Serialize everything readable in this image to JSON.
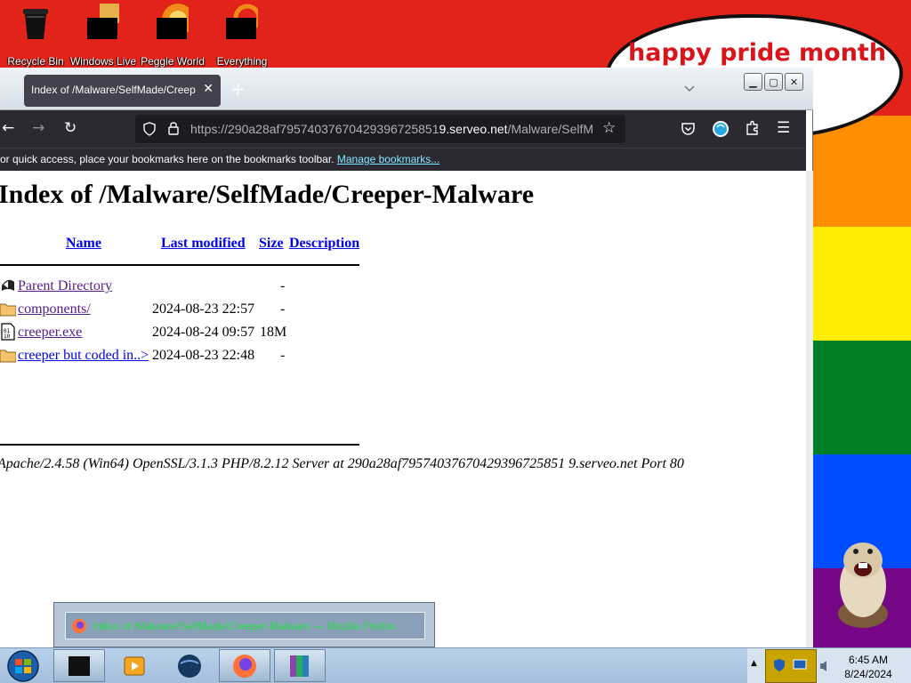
{
  "desktop": {
    "icons": [
      {
        "label": "Recycle Bin",
        "icon": "recycle-bin-icon"
      },
      {
        "label": "Windows Live",
        "icon": "windows-live-icon"
      },
      {
        "label": "Peggle World",
        "icon": "peggle-world-icon"
      },
      {
        "label": "Everything",
        "icon": "everything-search-icon"
      }
    ],
    "speech_bubble": "happy pride month",
    "colors": {
      "red": "#e2231a",
      "orange": "#fe8d00",
      "yellow": "#ffed00",
      "green": "#008026",
      "blue": "#004dff",
      "purple": "#750787"
    }
  },
  "browser": {
    "tab": {
      "title": "Index of /Malware/SelfMade/Creeper-Malware"
    },
    "url": {
      "prefix": "https://290a28af79574037670429396725851",
      "host_tail": "9.serveo.net",
      "path": "/Malware/SelfM"
    },
    "bookmarks_bar": {
      "text": "or quick access, place your bookmarks here on the bookmarks toolbar.",
      "link": "Manage bookmarks..."
    },
    "page": {
      "heading": "Index of /Malware/SelfMade/Creeper-Malware",
      "columns": [
        "Name",
        "Last modified",
        "Size",
        "Description"
      ],
      "rows": [
        {
          "name": "Parent Directory",
          "modified": "",
          "size": "-",
          "icon": "parent-directory-icon"
        },
        {
          "name": "components/",
          "modified": "2024-08-23 22:57",
          "size": "-",
          "icon": "folder-icon"
        },
        {
          "name": "creeper.exe",
          "modified": "2024-08-24 09:57",
          "size": "18M",
          "icon": "binary-file-icon"
        },
        {
          "name": "creeper but coded in..>",
          "modified": "2024-08-23 22:48",
          "size": "-",
          "icon": "folder-icon"
        }
      ],
      "address": "Apache/2.4.58 (Win64) OpenSSL/3.1.3 PHP/8.2.12 Server at 290a28af79574037670429396725851 9.serveo.net Port 80"
    }
  },
  "taskbar": {
    "preview_title": "Index of /Malware/SelfMade/Creeper-Malware — Mozilla Firefox",
    "clock": {
      "time": "6:45 AM",
      "date": "8/24/2024"
    }
  }
}
